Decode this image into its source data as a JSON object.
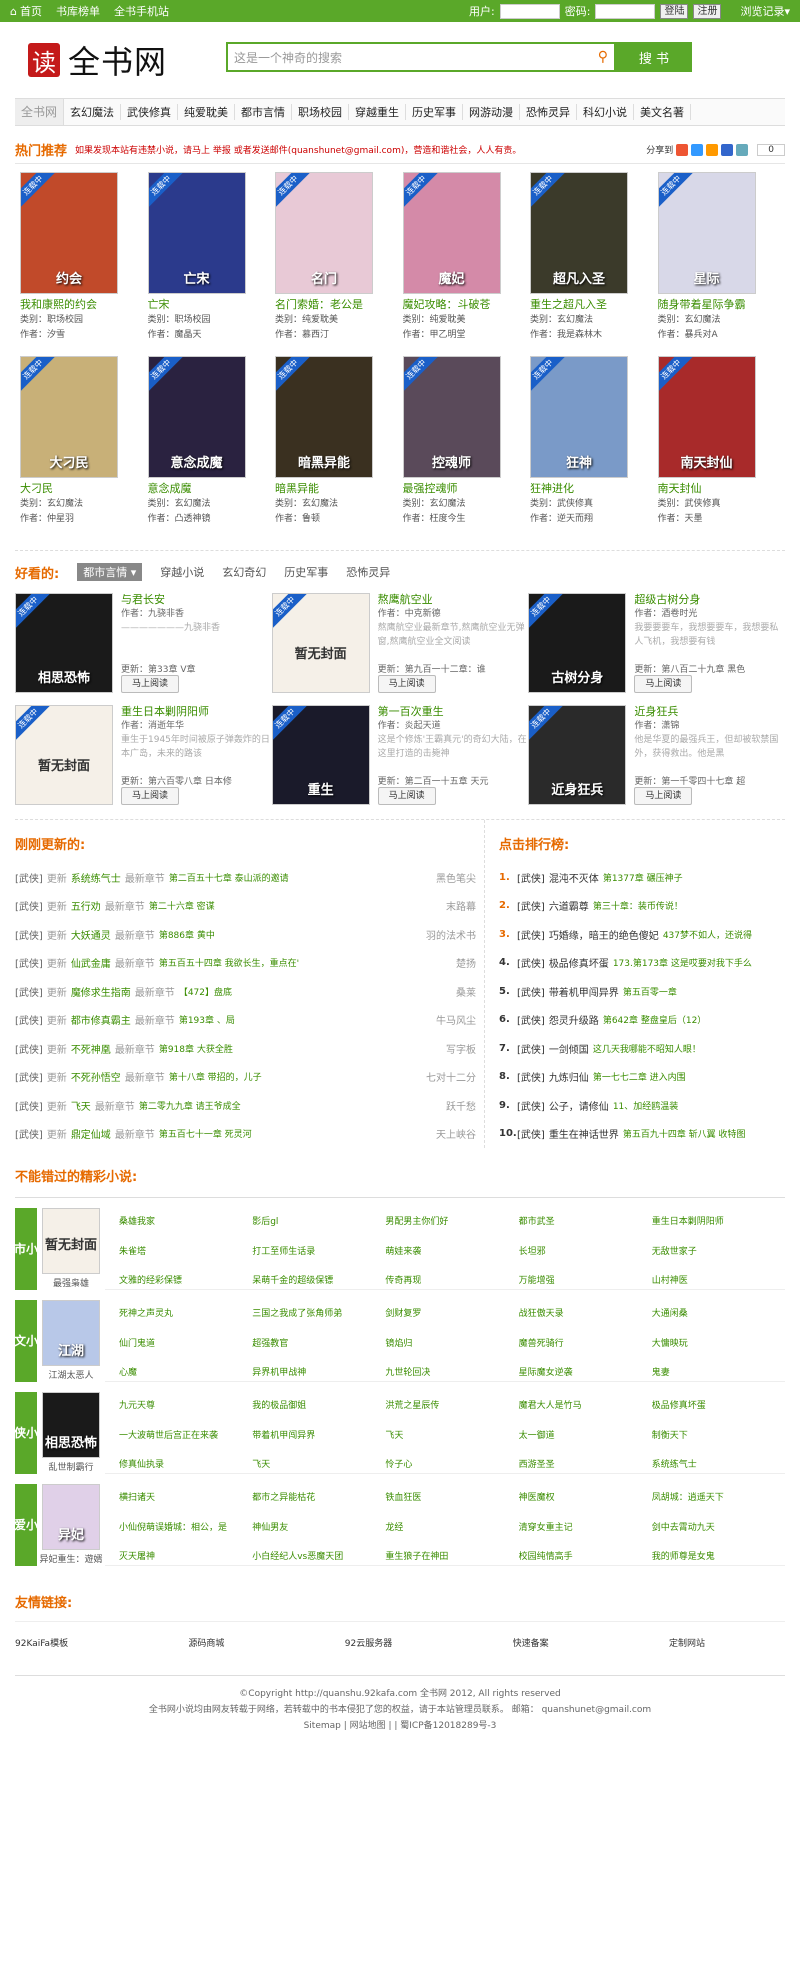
{
  "topbar": {
    "home": "首页",
    "rank": "书库榜单",
    "mobile": "全书手机站",
    "user_label": "用户:",
    "pass_label": "密码:",
    "login": "登陆",
    "register": "注册",
    "history": "浏览记录"
  },
  "header": {
    "logo_mark": "读",
    "logo_text": "全书网",
    "search_placeholder": "这是一个神奇的搜索",
    "search_btn": "搜 书"
  },
  "menu": [
    "全书网",
    "玄幻魔法",
    "武侠修真",
    "纯爱耽美",
    "都市言情",
    "职场校园",
    "穿越重生",
    "历史军事",
    "网游动漫",
    "恐怖灵异",
    "科幻小说",
    "美文名著"
  ],
  "hot": {
    "title": "热门推荐",
    "note": "如果发现本站有违禁小说，请马上 举报 或者发送邮件(quanshunet@gmail.com)，营造和谐社会，人人有责。",
    "share_label": "分享到",
    "share_count": "0",
    "books": [
      {
        "title": "我和康熙的约会",
        "cat": "类别：职场校园",
        "author": "作者：汐雪",
        "color": "#c14a2a",
        "cover_text": "约会"
      },
      {
        "title": "亡宋",
        "cat": "类别：职场校园",
        "author": "作者：魔晶天",
        "color": "#2b3a8c",
        "cover_text": "亡宋"
      },
      {
        "title": "名门索婚：老公是",
        "cat": "类别：纯爱耽美",
        "author": "作者：慕西汀",
        "color": "#e8c9d6",
        "cover_text": "名门"
      },
      {
        "title": "魔妃攻略：斗破苍",
        "cat": "类别：纯爱耽美",
        "author": "作者：甲乙明堂",
        "color": "#d48aa8",
        "cover_text": "魔妃"
      },
      {
        "title": "重生之超凡入圣",
        "cat": "类别：玄幻魔法",
        "author": "作者：我是森林木",
        "color": "#3b3a2a",
        "cover_text": "超凡入圣"
      },
      {
        "title": "随身带着星际争霸",
        "cat": "类别：玄幻魔法",
        "author": "作者：暴兵对A",
        "color": "#d8d8e8",
        "cover_text": "星际"
      },
      {
        "title": "大刁民",
        "cat": "类别：玄幻魔法",
        "author": "作者：仲星羽",
        "color": "#c8b078",
        "cover_text": "大刁民"
      },
      {
        "title": "意念成魔",
        "cat": "类别：玄幻魔法",
        "author": "作者：凸透神镜",
        "color": "#2a2240",
        "cover_text": "意念成魔"
      },
      {
        "title": "暗黑异能",
        "cat": "类别：玄幻魔法",
        "author": "作者：鲁顿",
        "color": "#3a3020",
        "cover_text": "暗黑异能"
      },
      {
        "title": "最强控魂师",
        "cat": "类别：玄幻魔法",
        "author": "作者：枉度今生",
        "color": "#5a4a5a",
        "cover_text": "控魂师"
      },
      {
        "title": "狂神进化",
        "cat": "类别：武侠修真",
        "author": "作者：逆天而翔",
        "color": "#7a9ac8",
        "cover_text": "狂神"
      },
      {
        "title": "南天封仙",
        "cat": "类别：武侠修真",
        "author": "作者：天墨",
        "color": "#a82a2a",
        "cover_text": "南天封仙"
      }
    ]
  },
  "good": {
    "title": "好看的:",
    "tabs": [
      "都市言情",
      "穿越小说",
      "玄幻奇幻",
      "历史军事",
      "恐怖灵异"
    ],
    "cards": [
      {
        "title": "与君长安",
        "author": "作者：九骁非香",
        "desc": "———————九骁非香",
        "latest": "更新：第33章 V章",
        "color": "#1a1a1a",
        "cover_text": "相思恐怖"
      },
      {
        "title": "熬鹰航空业",
        "author": "作者：中克新德",
        "desc": "熬鹰航空业最新章节,熬鹰航空业无弹窗,熬鹰航空业全文阅读",
        "latest": "更新：第九百一十二章：谁",
        "color": "#f5f0e8",
        "cover_text": "暂无封面"
      },
      {
        "title": "超级古树分身",
        "author": "作者：酒卷时光",
        "desc": "我要要要车，我想要要车，我想要私人飞机，我想要有钱",
        "latest": "更新：第八百二十九章 黑色",
        "color": "#1a1a1a",
        "cover_text": "古树分身"
      },
      {
        "title": "重生日本剿阴阳师",
        "author": "作者：消逝年华",
        "desc": "重生于1945年时间被原子弹轰炸的日本广岛，未来的路该",
        "latest": "更新：第六百零八章 日本修",
        "color": "#f5f0e8",
        "cover_text": "暂无封面"
      },
      {
        "title": "第一百次重生",
        "author": "作者：炎起天道",
        "desc": "这是个修炼'王霸真元'的奇幻大陆，在这里打造的击毙神",
        "latest": "更新：第二百一十五章 天元",
        "color": "#1a1a2a",
        "cover_text": "重生"
      },
      {
        "title": "近身狂兵",
        "author": "作者：潇锦",
        "desc": "他是华夏的最强兵王，但却被软禁国外，获得救出。他是黑",
        "latest": "更新：第一千零四十七章 超",
        "color": "#2a2a2a",
        "cover_text": "近身狂兵"
      }
    ],
    "read_btn": "马上阅读"
  },
  "updates": {
    "title": "刚刚更新的:",
    "cat": "[武侠]",
    "upd": "更新",
    "latest": "最新章节",
    "rows": [
      {
        "book": "系统练气士",
        "ch": "第二百五十七章 泰山派的邀请",
        "author": "黑色笔尖"
      },
      {
        "book": "五行劝",
        "ch": "第二十六章 密谋",
        "author": "末路幕"
      },
      {
        "book": "大妖通灵",
        "ch": "第886章 黄中",
        "author": "羽的法术书"
      },
      {
        "book": "仙武金庸",
        "ch": "第五百五十四章 我欲长生，重点在'欲'",
        "author": "楚扬"
      },
      {
        "book": "魔修求生指南",
        "ch": "【472】盘底",
        "author": "桑莱"
      },
      {
        "book": "都市修真霸主",
        "ch": "第193章 、局",
        "author": "牛马风尘"
      },
      {
        "book": "不死神凰",
        "ch": "第918章 大获全胜",
        "author": "写字板"
      },
      {
        "book": "不死孙悟空",
        "ch": "第十八章 带招的，儿子",
        "author": "七对十二分"
      },
      {
        "book": "飞天",
        "ch": "第二零九九章 请王爷成全",
        "author": "跃千愁"
      },
      {
        "book": "鼎定仙域",
        "ch": "第五百七十一章 死灵河",
        "author": "天上峡谷"
      }
    ]
  },
  "rank": {
    "title": "点击排行榜:",
    "cat": "[武侠]",
    "rows": [
      {
        "n": "1.",
        "book": "混沌不灭体",
        "ch": "第1377章 碾压神子"
      },
      {
        "n": "2.",
        "book": "六道霸尊",
        "ch": "第三十章：装币传说！"
      },
      {
        "n": "3.",
        "book": "巧婚缘，暗王的绝色傻妃",
        "ch": "437梦不如人，还说得"
      },
      {
        "n": "4.",
        "book": "极品修真坏蛋",
        "ch": "173.第173章 这是哎要对我下手么"
      },
      {
        "n": "5.",
        "book": "带着机甲闯异界",
        "ch": "第五百零一章"
      },
      {
        "n": "6.",
        "book": "怨灵升级路",
        "ch": "第642章 整盘皇后（12）"
      },
      {
        "n": "7.",
        "book": "一剑倾国",
        "ch": "这几天我哪能不昭知人眼！"
      },
      {
        "n": "8.",
        "book": "九炼归仙",
        "ch": "第一七七二章 进入内围"
      },
      {
        "n": "9.",
        "book": "公子，请修仙",
        "ch": "11、加经鸥温装"
      },
      {
        "n": "10.",
        "book": "重生在神话世界",
        "ch": "第五百九十四章 斩八翼 收特图"
      }
    ]
  },
  "missed": {
    "title": "不能错过的精彩小说:",
    "cats": [
      {
        "side": "都市小说",
        "pic_title": "最强枭雄",
        "color": "#f5f0e8",
        "cover_text": "暂无封面",
        "links": [
          "桑雄我家",
          "影后gl",
          "男配男主你们好",
          "都市武圣",
          "重生日本剿阴阳师",
          "朱雀塔",
          "打工至师生话录",
          "萌娃来袭",
          "长坦邪",
          "无敌世家子",
          "文雅的经彩保镖",
          "呆萌千金的超级保镖",
          "传奇再现",
          "万能增强",
          "山村神医"
        ]
      },
      {
        "side": "美文小说",
        "pic_title": "江湖太恶人",
        "color": "#b8c8e8",
        "cover_text": "江湖",
        "links": [
          "死神之声灵丸",
          "三国之我成了张角师弟",
          "剑财复罗",
          "战狂傲天录",
          "大通闲桑",
          "仙门鬼道",
          "超强教官",
          "镜焰归",
          "魔兽死骑行",
          "大慵映玩",
          "心魔",
          "异界机甲战神",
          "九世轮回决",
          "星际魔女逆袭",
          "鬼妻"
        ]
      },
      {
        "side": "武侠小说",
        "pic_title": "乱世制霸行",
        "color": "#1a1a1a",
        "cover_text": "相思恐怖",
        "links": [
          "九元天尊",
          "我的极品御姐",
          "洪荒之星辰传",
          "魔君大人是竹马",
          "极品修真坏蛋",
          "一大波萌世后宫正在来袭",
          "带着机甲闯异界",
          "飞天",
          "太一御道",
          "制衡天下",
          "修真仙执录",
          "飞天",
          "怜子心",
          "西游圣圣",
          "系统练气士"
        ]
      },
      {
        "side": "纯爱小说",
        "pic_title": "异妃重生：遊婿",
        "color": "#e0d0e8",
        "cover_text": "异妃",
        "links": [
          "横扫诸天",
          "都市之异能枯花",
          "铁血狂医",
          "神医魔权",
          "凤胡城：逍遥天下",
          "小仙倪萌误婚城：相公，是",
          "神仙男友",
          "龙经",
          "清穿女重主记",
          "剑中去霄动九天",
          "灭天屠神",
          "小白经纪人vs恶魔天团",
          "重生狼子在神田",
          "校园纯情高手",
          "我的师尊是女鬼"
        ]
      }
    ]
  },
  "friend": {
    "title": "友情链接:",
    "links": [
      "92KaiFa模板",
      "源码商城",
      "92云服务器",
      "快速备案",
      "定制网站"
    ]
  },
  "footer": {
    "line1": "©Copyright http://quanshu.92kafa.com 全书网 2012, All rights reserved",
    "line2": "全书网小说均由网友转载于网络，若转载中的书本侵犯了您的权益，请于本站管理员联系。 邮箱： quanshunet@gmail.com",
    "line3": "Sitemap | 网站地图 | | 蜀ICP备12018289号-3"
  }
}
